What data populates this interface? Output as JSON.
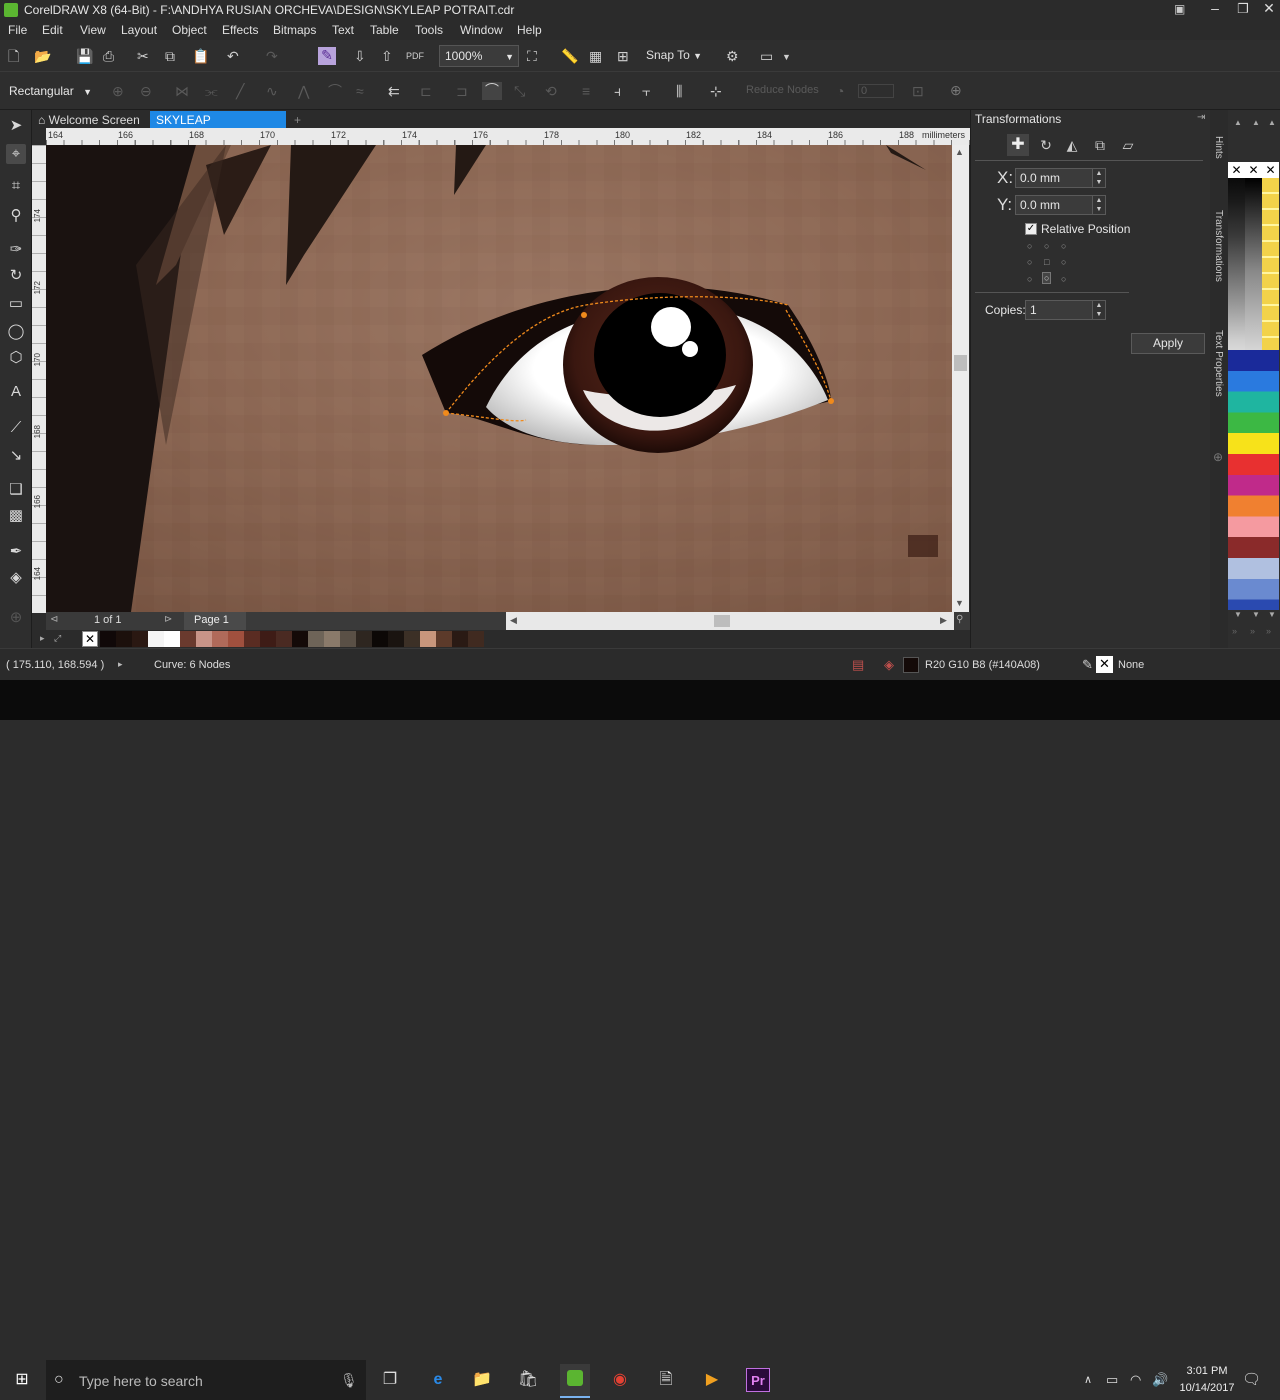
{
  "window": {
    "title": "CorelDRAW X8 (64-Bit) - F:\\ANDHYA RUSIAN ORCHEVA\\DESIGN\\SKYLEAP POTRAIT.cdr",
    "controls": [
      "minimize",
      "maximize",
      "close"
    ]
  },
  "menu": [
    "File",
    "Edit",
    "View",
    "Layout",
    "Object",
    "Effects",
    "Bitmaps",
    "Text",
    "Table",
    "Tools",
    "Window",
    "Help"
  ],
  "toolbar1": {
    "zoom_value": "1000%",
    "snap_to_label": "Snap To"
  },
  "toolbar2": {
    "selection_mode": "Rectangular",
    "reduce_nodes_label": "Reduce Nodes",
    "smoothness_value": "0"
  },
  "tabs": {
    "welcome": "Welcome Screen",
    "document": "SKYLEAP POTRAIT.cdr"
  },
  "ruler": {
    "h_ticks": [
      "164",
      "166",
      "168",
      "170",
      "172",
      "174",
      "176",
      "178",
      "180",
      "182",
      "184",
      "186",
      "188"
    ],
    "unit": "millimeters",
    "v_ticks": [
      "174",
      "172",
      "170",
      "168",
      "166",
      "164"
    ]
  },
  "page_nav": {
    "position": "1 of 1",
    "page_label": "Page 1"
  },
  "status": {
    "coordinates": "( 175.110, 168.594 )",
    "object_info": "Curve: 6 Nodes",
    "fill_color": "R20 G10 B8 (#140A08)",
    "outline": "None"
  },
  "docker": {
    "title": "Transformations",
    "x_label": "X:",
    "x_value": "0.0 mm",
    "y_label": "Y:",
    "y_value": "0.0 mm",
    "relative_position_label": "Relative Position",
    "relative_position_checked": true,
    "copies_label": "Copies:",
    "copies_value": "1",
    "apply_label": "Apply"
  },
  "side_tabs": [
    "Hints",
    "Transformations",
    "Text Properties"
  ],
  "colors": {
    "accent": "#1e88e5",
    "fill_swatch": "#140A08",
    "node_outline": "#f08a1c"
  },
  "taskbar": {
    "search_placeholder": "Type here to search",
    "time": "3:01 PM",
    "date": "10/14/2017"
  }
}
